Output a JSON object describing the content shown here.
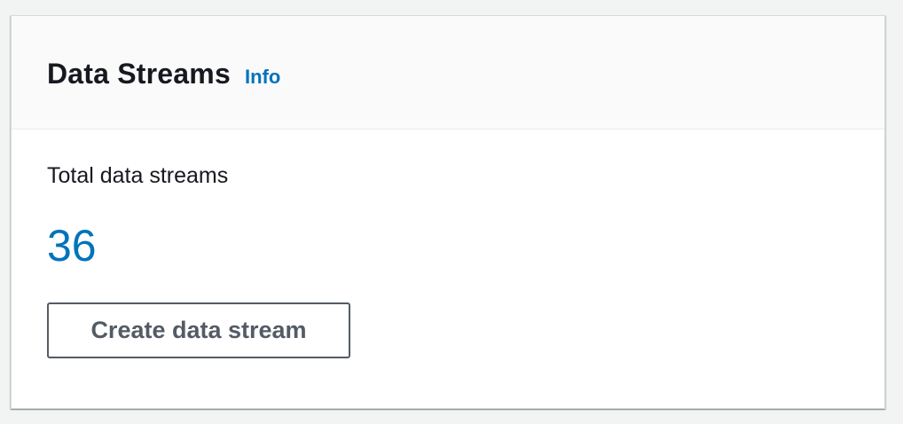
{
  "panel": {
    "title": "Data Streams",
    "info_link": "Info",
    "stat_label": "Total data streams",
    "stat_value": "36",
    "create_button_label": "Create data stream"
  },
  "colors": {
    "accent": "#0073bb",
    "button_text": "#545b64",
    "header_background": "#fafafa",
    "page_background": "#f2f3f3"
  }
}
